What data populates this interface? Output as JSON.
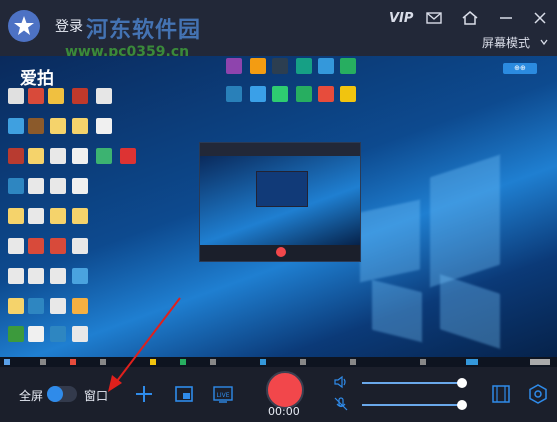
{
  "header": {
    "login_label": "登录",
    "vip_label": "VIP",
    "mode_label": "屏幕模式"
  },
  "watermark": {
    "title": "河东软件园",
    "url": "www.pc0359.cn"
  },
  "desktop": {
    "app_name": "爱拍",
    "badge_text": "⊕⊕"
  },
  "controls": {
    "fullscreen_label": "全屏",
    "window_label": "窗口",
    "timer": "00:00",
    "speaker_volume": 0.97,
    "mic_volume": 0.97
  },
  "colors": {
    "accent": "#2f8bea",
    "record": "#f2474b",
    "panel": "#1b1f2b",
    "annotation_arrow": "#e0201c"
  }
}
